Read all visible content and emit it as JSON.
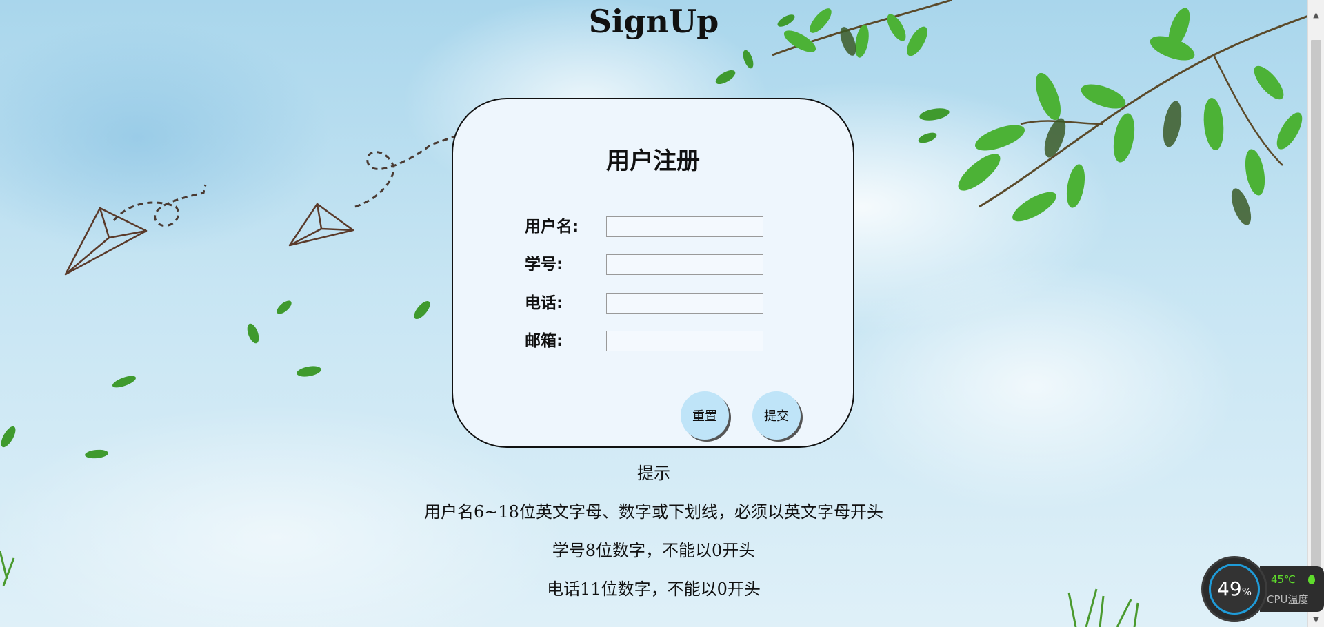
{
  "page": {
    "title": "SignUp"
  },
  "form": {
    "title": "用户注册",
    "fields": [
      {
        "label": "用户名:",
        "value": ""
      },
      {
        "label": "学号:",
        "value": ""
      },
      {
        "label": "电话:",
        "value": ""
      },
      {
        "label": "邮箱:",
        "value": ""
      }
    ],
    "reset_label": "重置",
    "submit_label": "提交"
  },
  "hints": {
    "heading": "提示",
    "items": [
      "用户名6~18位英文字母、数字或下划线，必须以英文字母开头",
      "学号8位数字，不能以0开头",
      "电话11位数字，不能以0开头"
    ]
  },
  "cpu_widget": {
    "usage_value": "49",
    "usage_unit": "%",
    "temperature": "45℃",
    "label": "CPU温度"
  },
  "colors": {
    "card_background": "#eef6fd",
    "button_background": "#bfe4f8",
    "cpu_accent": "#1f9bd8",
    "cpu_temp": "#5fdc2c"
  }
}
